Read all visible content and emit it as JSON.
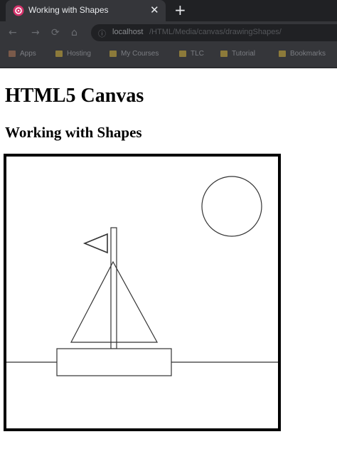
{
  "browser": {
    "tab": {
      "title": "Working with Shapes",
      "close_glyph": "✕",
      "favicon": "pink-app-icon"
    },
    "new_tab_glyph": "+",
    "nav": {
      "back": "←",
      "forward": "→",
      "reload": "⟳",
      "home": "⌂"
    },
    "address": {
      "icon": "info-icon",
      "host": "localhost",
      "path": "/HTML/Media/canvas/drawingShapes/"
    },
    "bookmarks": [
      {
        "label": "Apps",
        "icon": "apps-grid-icon"
      },
      {
        "label": "Hosting",
        "icon": "folder-icon"
      },
      {
        "label": "My Courses",
        "icon": "folder-icon"
      },
      {
        "label": "TLC",
        "icon": "folder-icon"
      },
      {
        "label": "Tutorial",
        "icon": "folder-icon"
      },
      {
        "label": "Bookmarks",
        "icon": "folder-icon"
      }
    ]
  },
  "page": {
    "heading": "HTML5 Canvas",
    "subheading": "Working with Shapes"
  },
  "colors": {
    "stroke": "#333333",
    "frame": "#000000",
    "background": "#ffffff"
  }
}
